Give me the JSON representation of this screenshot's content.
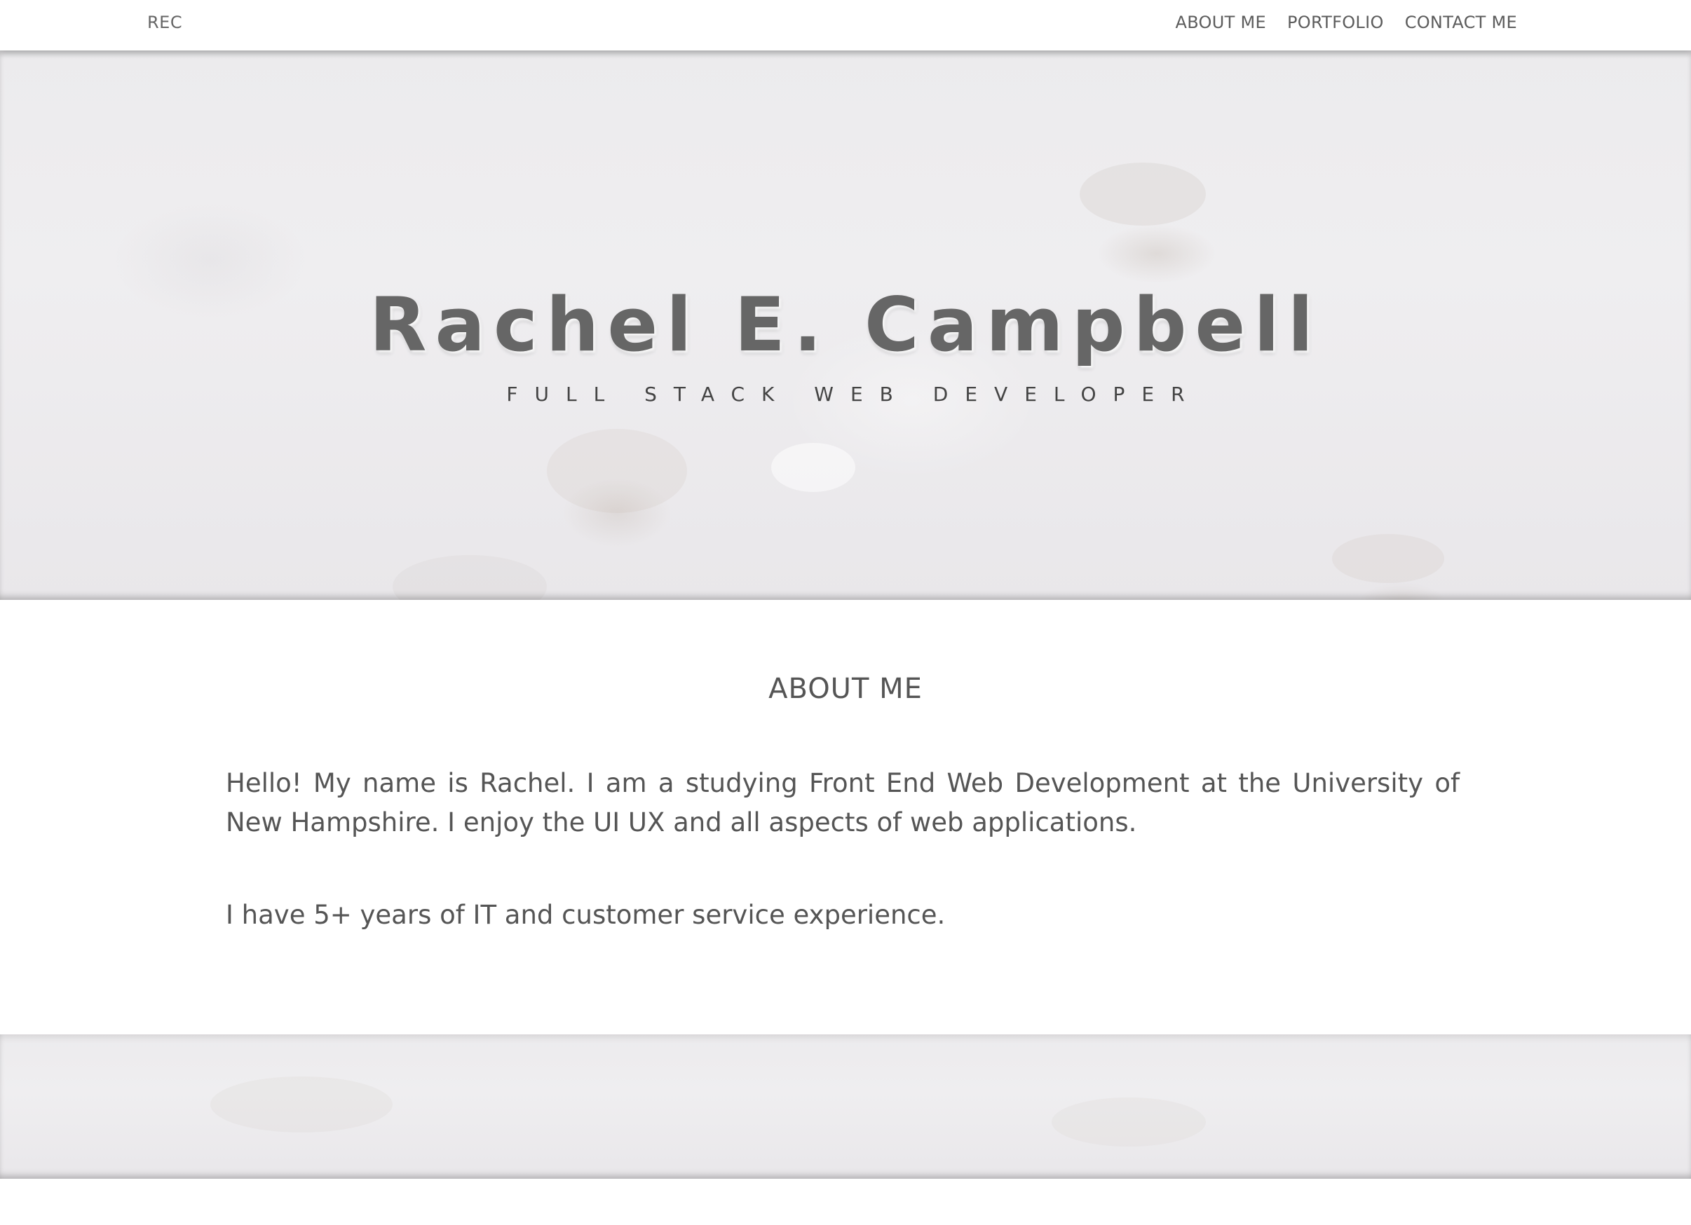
{
  "nav": {
    "brand": "REC",
    "links": [
      "ABOUT ME",
      "PORTFOLIO",
      "CONTACT ME"
    ]
  },
  "hero": {
    "title": "Rachel E. Campbell",
    "subtitle": "FULL STACK WEB DEVELOPER"
  },
  "about": {
    "heading": "ABOUT ME",
    "paragraphs": [
      "Hello! My name is Rachel. I am a studying Front End Web Development at the University of New Hampshire. I enjoy the UI UX and all aspects of web applications.",
      "I have 5+ years of IT and customer service experience."
    ]
  },
  "colors": {
    "text": "#555555",
    "navbar_bg": "#ffffff",
    "texture_bg": "#ecebed"
  }
}
